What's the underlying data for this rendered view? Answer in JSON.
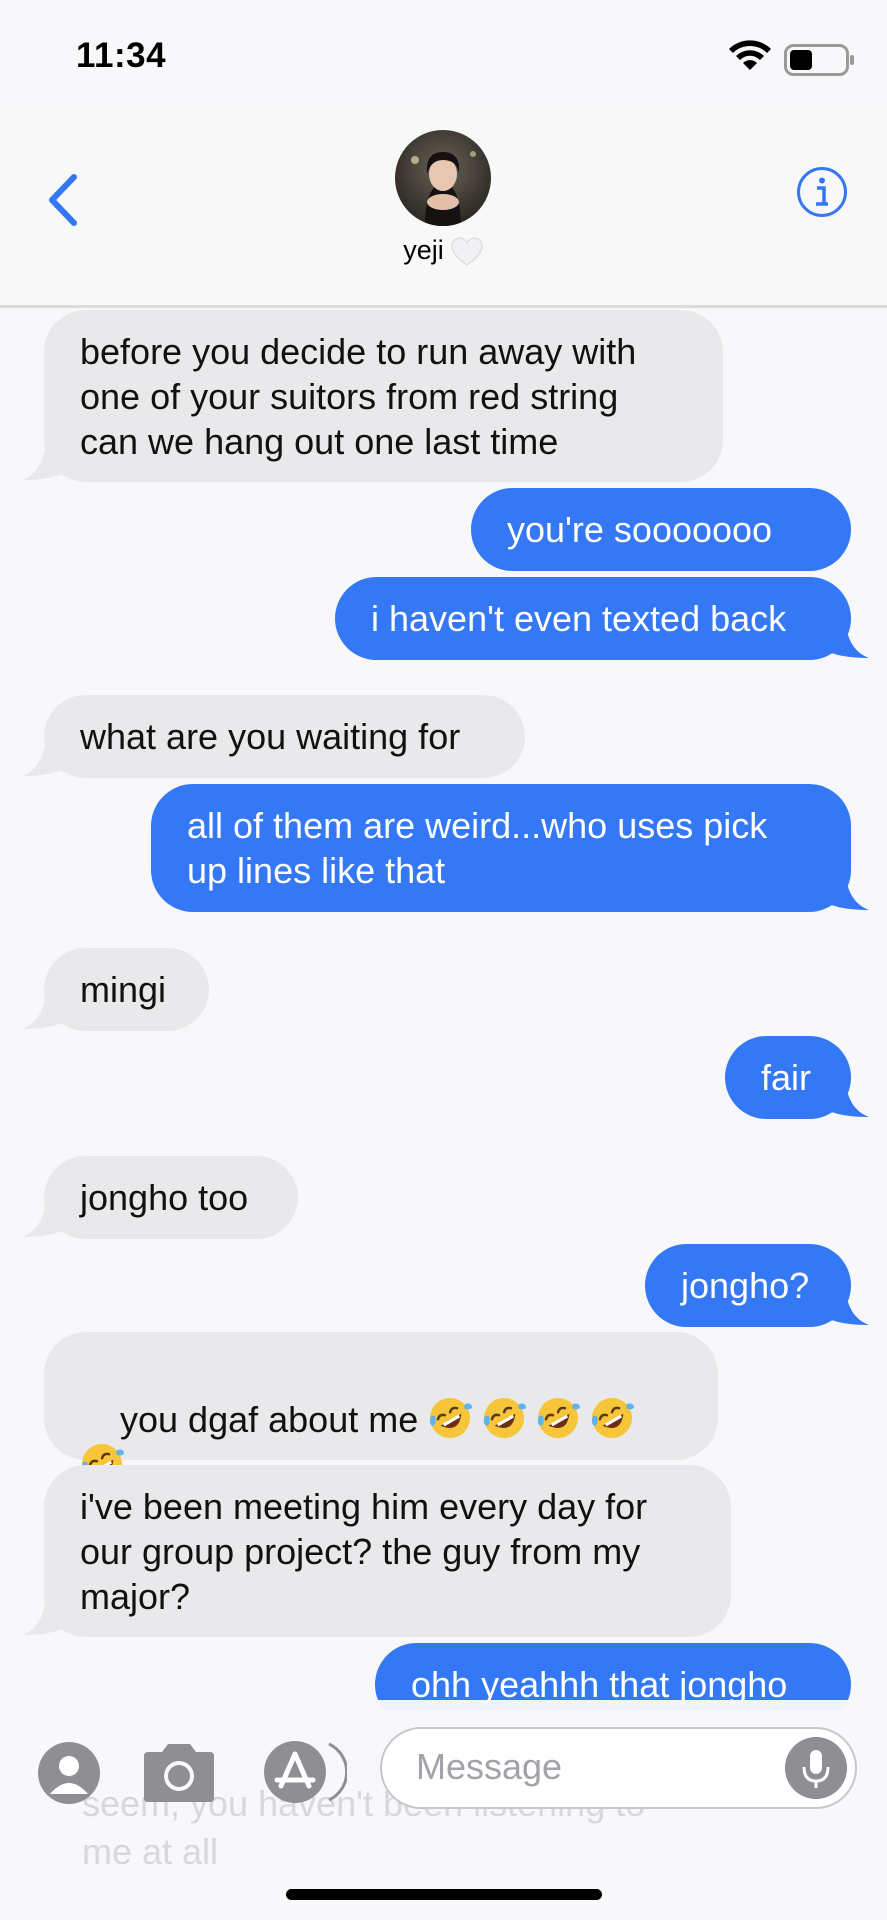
{
  "status": {
    "time": "11:34"
  },
  "contact": {
    "name": "yeji"
  },
  "messages": [
    {
      "id": "m1",
      "from": "them",
      "text": "before you decide to run away with\none of your suitors from red string\ncan we hang out one last time"
    },
    {
      "id": "m2",
      "from": "me",
      "text": "you're sooooooo"
    },
    {
      "id": "m3",
      "from": "me",
      "text": "i haven't even texted back"
    },
    {
      "id": "m4",
      "from": "them",
      "text": "what are you waiting for"
    },
    {
      "id": "m5",
      "from": "me",
      "text": "all of them are weird...who uses pick\nup lines like that"
    },
    {
      "id": "m6",
      "from": "them",
      "text": "mingi"
    },
    {
      "id": "m7",
      "from": "me",
      "text": "fair"
    },
    {
      "id": "m8",
      "from": "them",
      "text": "jongho too"
    },
    {
      "id": "m9",
      "from": "me",
      "text": "jongho?"
    },
    {
      "id": "m10",
      "from": "them",
      "text": "you dgaf about me",
      "emoji": "rolling-on-floor-laughing",
      "emoji_count": 6
    },
    {
      "id": "m11",
      "from": "them",
      "text": "i've been meeting him every day for\nour group project? the guy from my\nmajor?"
    },
    {
      "id": "m12",
      "from": "me",
      "text": "ohh yeahhh that jongho"
    }
  ],
  "composer": {
    "placeholder": "Message",
    "ghost_text": "seem, you haven't been listening to\nme at all"
  },
  "icons": [
    "back-chevron-icon",
    "info-icon",
    "heart-icon",
    "contact-icon",
    "camera-icon",
    "app-store-icon",
    "mic-icon",
    "wifi-icon",
    "battery-icon"
  ],
  "colors": {
    "accent": "#3478f6",
    "received_bubble": "#e9e9eb",
    "background": "#f8f8fa"
  }
}
